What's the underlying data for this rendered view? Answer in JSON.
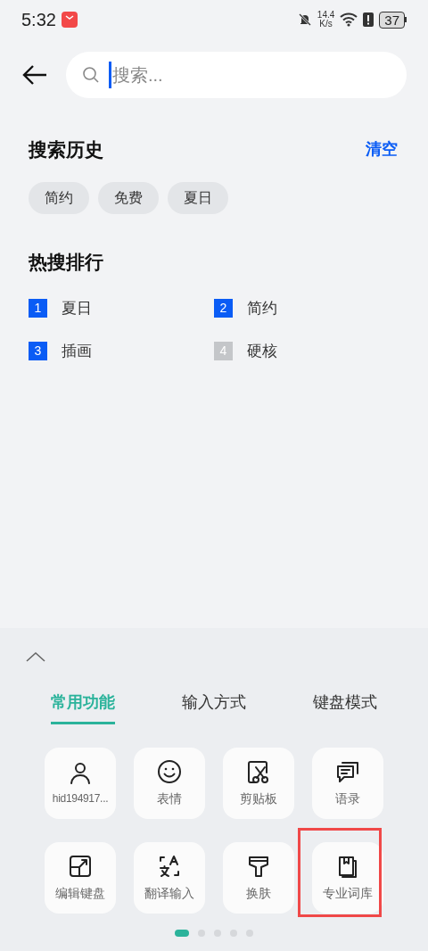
{
  "status_bar": {
    "time": "5:32",
    "net_speed": "14.4",
    "net_unit": "K/s",
    "battery": "37"
  },
  "search": {
    "placeholder": "搜索..."
  },
  "history": {
    "title": "搜索历史",
    "clear": "清空",
    "items": [
      "简约",
      "免费",
      "夏日"
    ]
  },
  "hot": {
    "title": "热搜排行",
    "items": [
      {
        "rank": "1",
        "label": "夏日",
        "color": "#0a5cf5"
      },
      {
        "rank": "2",
        "label": "简约",
        "color": "#0a5cf5"
      },
      {
        "rank": "3",
        "label": "插画",
        "color": "#0a5cf5"
      },
      {
        "rank": "4",
        "label": "硬核",
        "color": "#c4c6c9"
      }
    ]
  },
  "panel": {
    "tabs": [
      {
        "label": "常用功能",
        "selected": true
      },
      {
        "label": "输入方式",
        "selected": false
      },
      {
        "label": "键盘模式",
        "selected": false
      }
    ],
    "tiles": [
      {
        "label": "hid194917...",
        "highlighted": false
      },
      {
        "label": "表情",
        "highlighted": false
      },
      {
        "label": "剪贴板",
        "highlighted": false
      },
      {
        "label": "语录",
        "highlighted": false
      },
      {
        "label": "编辑键盘",
        "highlighted": false
      },
      {
        "label": "翻译输入",
        "highlighted": false
      },
      {
        "label": "换肤",
        "highlighted": false
      },
      {
        "label": "专业词库",
        "highlighted": true
      }
    ],
    "pages": [
      {
        "selected": true
      },
      {
        "selected": false
      },
      {
        "selected": false
      },
      {
        "selected": false
      },
      {
        "selected": false
      }
    ]
  }
}
